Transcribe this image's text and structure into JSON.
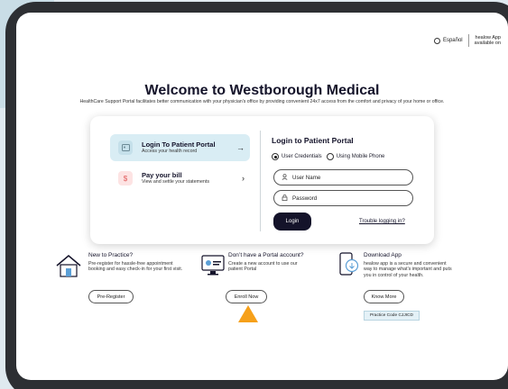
{
  "header": {
    "language_label": "Español",
    "app_note_line1": "healow App",
    "app_note_line2": "available on"
  },
  "hero": {
    "title": "Welcome to Westborough Medical",
    "subtitle": "HealthCare Support Portal facilitates better communication with your physician's office by providing convenient 24x7 access from the comfort and privacy of your home or office."
  },
  "options": [
    {
      "title": "Login To Patient Portal",
      "subtitle": "Access your health record",
      "chevron": "→"
    },
    {
      "title": "Pay your bill",
      "subtitle": "View and settle your statements",
      "chevron": "›",
      "icon_char": "$"
    }
  ],
  "login": {
    "title": "Login to Patient Portal",
    "radio_credentials": "User Credentials",
    "radio_phone": "Using Mobile Phone",
    "username_placeholder": "User Name",
    "password_placeholder": "Password",
    "login_button": "Login",
    "trouble_link": "Trouble logging in?"
  },
  "columns": {
    "new": {
      "title": "New to Practice?",
      "text": "Pre-register for hassle-free appointment booking and easy check-in for your first visit.",
      "button": "Pre-Register"
    },
    "account": {
      "title": "Don’t have a Portal account?",
      "text": "Create a new account to use our patient Portal",
      "button": "Enroll Now"
    },
    "app": {
      "title": "Download App",
      "text": "healow app is a secure and convenient way to manage what's important and puts you in control of your health.",
      "button": "Know More",
      "practice_code": "Practice Code CJJICD"
    }
  },
  "colors": {
    "brand_navy": "#14132a",
    "highlight_bg": "#d9edf4",
    "accent_arrow": "#f6a01a",
    "bill_icon": "#e05757"
  }
}
